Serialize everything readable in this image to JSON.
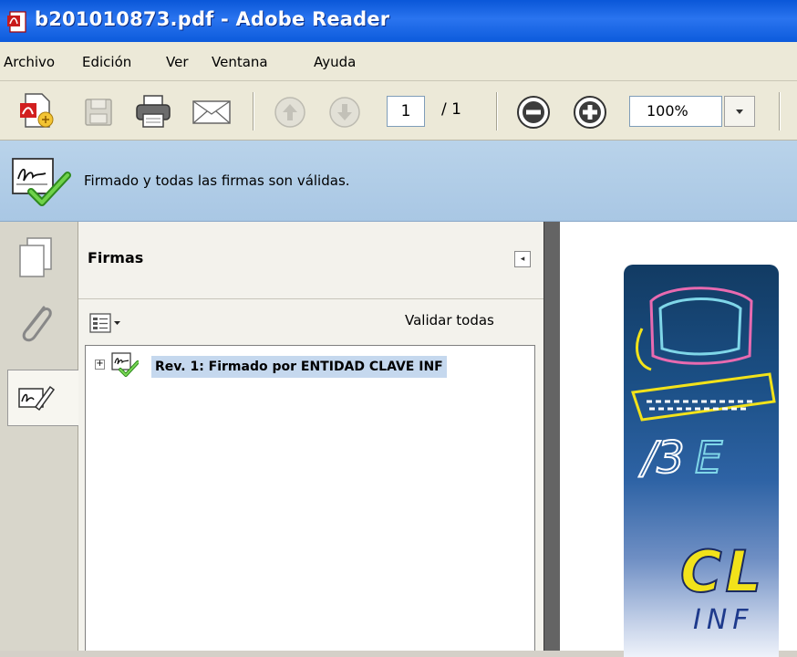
{
  "window": {
    "title": "b201010873.pdf - Adobe Reader"
  },
  "menu": {
    "items": [
      "Archivo",
      "Edición",
      "Ver",
      "Ventana",
      "Ayuda"
    ]
  },
  "toolbar": {
    "current_page": "1",
    "total_pages": "/ 1",
    "zoom": "100%"
  },
  "signature_bar": {
    "message": "Firmado y todas las firmas son válidas."
  },
  "signatures_panel": {
    "title": "Firmas",
    "validate_all": "Validar todas",
    "items": [
      {
        "label": "Rev. 1: Firmado por ENTIDAD CLAVE INF"
      }
    ]
  },
  "document": {
    "logo_text": "CL",
    "logo_subtext": "INF"
  },
  "colors": {
    "titlebar": "#0a57d8",
    "signature_bar": "#b9d3ea",
    "selection": "#c5d8ee",
    "logo_yellow": "#f2e21a"
  }
}
